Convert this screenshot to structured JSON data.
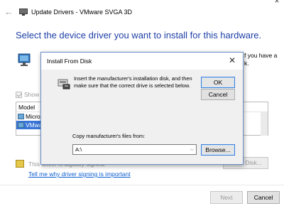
{
  "wizard": {
    "title": "Update Drivers - VMware SVGA 3D",
    "heading": "Select the device driver you want to install for this hardware.",
    "desc_left": "S",
    "desc_right_1": "f you have a",
    "desc_right_2": "k.",
    "show_compatible": "Show co",
    "model_header": "Model",
    "model_items": [
      "Micro",
      "VMwa"
    ],
    "unsigned_text": "This driver is digitally signed.",
    "signing_link": "Tell me why driver signing is important",
    "have_disk": "Have Disk...",
    "next_label": "Next",
    "cancel_label": "Cancel",
    "close_glyph": "×",
    "back_glyph": "←"
  },
  "dialog": {
    "title": "Install From Disk",
    "close_glyph": "✕",
    "message": "Insert the manufacturer's installation disk, and then make sure that the correct drive is selected below.",
    "ok_label": "OK",
    "cancel_label": "Cancel",
    "copy_label": "Copy manufacturer's files from:",
    "path_value": "A:\\",
    "browse_label": "Browse...",
    "dropdown_glyph": "⌵"
  }
}
